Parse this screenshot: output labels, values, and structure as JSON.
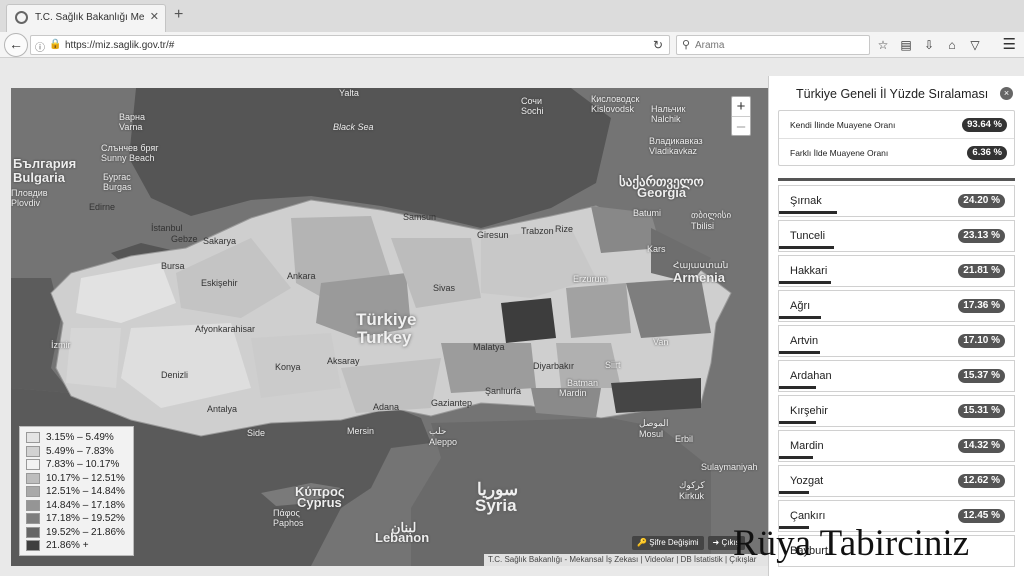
{
  "browser": {
    "tab_title": "T.C. Sağlık Bakanlığı Mekan...",
    "tab_close": "✕",
    "new_tab": "+",
    "url": "https://miz.saglik.gov.tr/#",
    "search_placeholder": "Arama"
  },
  "map": {
    "zoom_in": "+",
    "zoom_out": "–",
    "labels": {
      "yalta": "Yalta",
      "sochi": "Сочи\nSochi",
      "kislovodsk": "Кисловодск\nKislovodsk",
      "nalchik": "Нальчик\nNalchik",
      "vladikavkaz": "Владикавказ\nVladikavkaz",
      "varna": "Варна\nVarna",
      "sunny_beach": "Слънчев бряг\nSunny Beach",
      "bulgaria_local": "България",
      "bulgaria": "Bulgaria",
      "burgas": "Бургас\nBurgas",
      "plovdiv": "Пловдив\nPlovdiv",
      "black_sea": "Black Sea",
      "georgia_local": "საქართველო",
      "georgia": "Georgia",
      "batumi": "Batumi",
      "tbilisi": "თბილისი\nTbilisi",
      "armenia_local": "Հայաստան",
      "armenia": "Armenia",
      "edirne": "Edirne",
      "istanbul": "İstanbul",
      "gebze": "Gebze",
      "sakarya": "Sakarya",
      "bursa": "Bursa",
      "eskisehir": "Eskişehir",
      "ankara": "Ankara",
      "samsun": "Samsun",
      "giresun": "Giresun",
      "trabzon": "Trabzon",
      "rize": "Rize",
      "kars": "Kars",
      "erzurum": "Erzurum",
      "sivas": "Sivas",
      "turkiye": "Türkiye",
      "turkey": "Turkey",
      "malatya": "Malatya",
      "van": "Van",
      "afyon": "Afyonkarahisar",
      "konya": "Konya",
      "aksaray": "Aksaray",
      "diyarbakir": "Diyarbakır",
      "batman": "Batman",
      "siirt": "Siirt",
      "mardin": "Mardin",
      "sanliurfa": "Şanlıurfa",
      "gaziantep": "Gaziantep",
      "adana": "Adana",
      "mersin": "Mersin",
      "antalya": "Antalya",
      "denizli": "Denizli",
      "izmir": "İzmir",
      "side": "Side",
      "aleppo": "حلب\nAleppo",
      "mosul": "الموصل\nMosul",
      "erbil": "Erbil",
      "sulaymaniyah": "Sulaymaniyah",
      "kirkuk": "كركوك\nKirkuk",
      "syria_local": "سوريا",
      "syria": "Syria",
      "cyprus_local": "Κύπρος",
      "cyprus": "Cyprus",
      "paphos": "Πάφος\nPaphos",
      "lebanon_local": "لبنان",
      "lebanon": "Lebanon"
    },
    "legend": [
      {
        "label": "3.15% – 5.49%",
        "color": "#e4e4e4"
      },
      {
        "label": "5.49% – 7.83%",
        "color": "#d2d2d2"
      },
      {
        "label": "7.83% – 10.17%",
        "color": "#f2f2f2"
      },
      {
        "label": "10.17% – 12.51%",
        "color": "#bdbdbd"
      },
      {
        "label": "12.51% – 14.84%",
        "color": "#a9a9a9"
      },
      {
        "label": "14.84% – 17.18%",
        "color": "#959595"
      },
      {
        "label": "17.18% – 19.52%",
        "color": "#7e7e7e"
      },
      {
        "label": "19.52% – 21.86%",
        "color": "#666666"
      },
      {
        "label": "21.86% +",
        "color": "#3f3f3f"
      }
    ],
    "buttons": {
      "change_password": "Şifre Değişimi",
      "logout": "Çıkış"
    },
    "attribution": "T.C. Sağlık Bakanlığı - Mekansal İş Zekası | Videolar | DB İstatistik | Çıkışlar"
  },
  "panel": {
    "title": "Türkiye Geneli İl Yüzde Sıralaması",
    "close": "×",
    "summary": [
      {
        "label": "Kendi İlinde Muayene Oranı",
        "value": "93.64 %"
      },
      {
        "label": "Farklı İlde Muayene Oranı",
        "value": "6.36 %"
      }
    ],
    "ranking": [
      {
        "name": "Şırnak",
        "pct": "24.20 %",
        "value": 24.2
      },
      {
        "name": "Tunceli",
        "pct": "23.13 %",
        "value": 23.13
      },
      {
        "name": "Hakkari",
        "pct": "21.81 %",
        "value": 21.81
      },
      {
        "name": "Ağrı",
        "pct": "17.36 %",
        "value": 17.36
      },
      {
        "name": "Artvin",
        "pct": "17.10 %",
        "value": 17.1
      },
      {
        "name": "Ardahan",
        "pct": "15.37 %",
        "value": 15.37
      },
      {
        "name": "Kırşehir",
        "pct": "15.31 %",
        "value": 15.31
      },
      {
        "name": "Mardin",
        "pct": "14.32 %",
        "value": 14.32
      },
      {
        "name": "Yozgat",
        "pct": "12.62 %",
        "value": 12.62
      },
      {
        "name": "Çankırı",
        "pct": "12.45 %",
        "value": 12.45
      },
      {
        "name": "Bayburt",
        "pct": "",
        "value": null
      }
    ]
  },
  "watermark": "Rüya Tabirciniz"
}
